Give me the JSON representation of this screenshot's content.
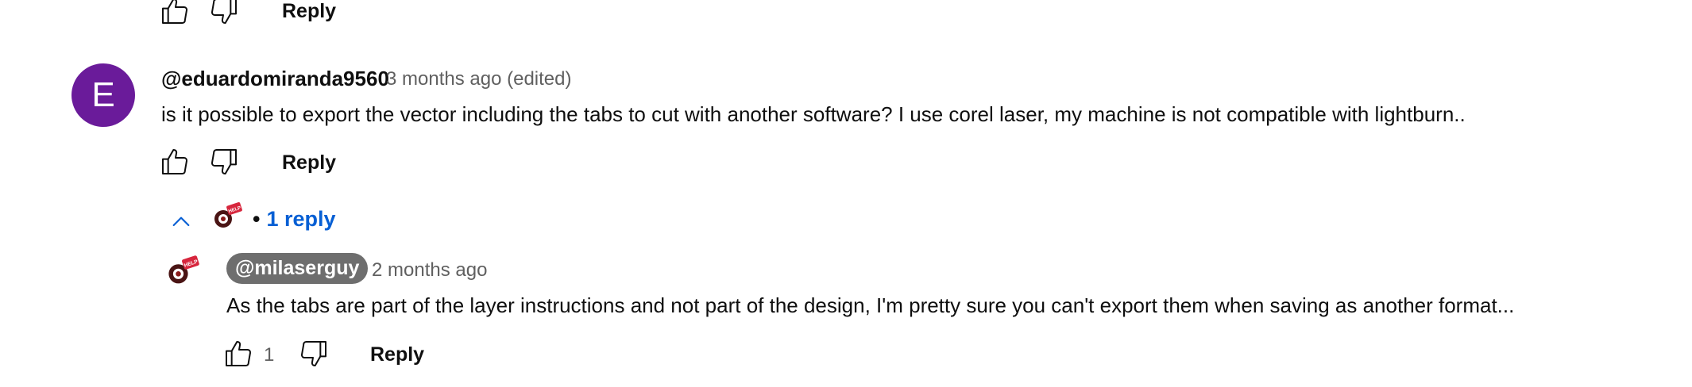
{
  "top_actions": {
    "reply_label": "Reply"
  },
  "comment": {
    "avatar_letter": "E",
    "avatar_color": "#6a1b9a",
    "author": "@eduardomiranda9560",
    "timestamp": "3 months ago (edited)",
    "text": "is it possible to export the vector including the tabs to cut with another software? I use corel laser, my machine is not compatible with lightburn..",
    "reply_label": "Reply",
    "replies_toggle": {
      "separator": "•",
      "label": "1 reply"
    }
  },
  "reply": {
    "author": "@milaserguy",
    "timestamp": "2 months ago",
    "text": "As the tabs are part of the layer instructions and not part of the design, I'm pretty sure you can't export them when saving as another format...",
    "like_count": "1",
    "reply_label": "Reply",
    "avatar_badge": "HELP"
  },
  "icons": {
    "like": "thumb-up-icon",
    "dislike": "thumb-down-icon",
    "collapse": "chevron-up-icon"
  },
  "colors": {
    "link_blue": "#065fd4",
    "badge_gray": "#6e6e6e",
    "secondary_text": "#606060"
  }
}
